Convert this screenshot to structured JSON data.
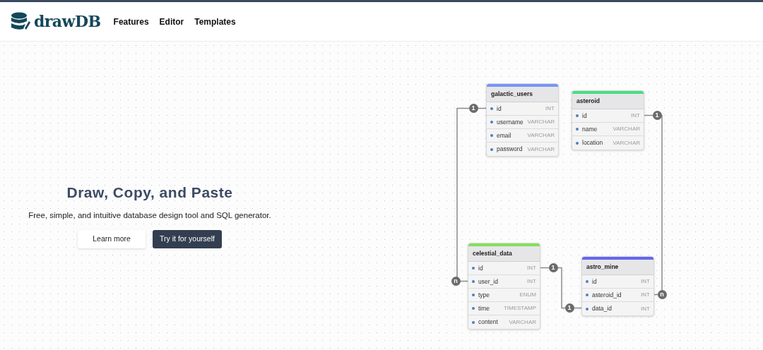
{
  "nav": {
    "logo_text": "drawDB",
    "links": [
      "Features",
      "Editor",
      "Templates"
    ]
  },
  "hero": {
    "title": "Draw, Copy, and Paste",
    "subtitle": "Free, simple, and intuitive database design tool and SQL generator.",
    "buttons": [
      {
        "label": "Learn more",
        "kind": "secondary"
      },
      {
        "label": "Try it for yourself",
        "kind": "primary"
      }
    ]
  },
  "tables": [
    {
      "name": "galactic_users",
      "color": "#7895f5",
      "fields": [
        {
          "name": "id",
          "type": "INT"
        },
        {
          "name": "username",
          "type": "VARCHAR"
        },
        {
          "name": "email",
          "type": "VARCHAR"
        },
        {
          "name": "password",
          "type": "VARCHAR"
        }
      ]
    },
    {
      "name": "asteroid",
      "color": "#4ade80",
      "fields": [
        {
          "name": "id",
          "type": "INT"
        },
        {
          "name": "name",
          "type": "VARCHAR"
        },
        {
          "name": "location",
          "type": "VARCHAR"
        }
      ]
    },
    {
      "name": "celestial_data",
      "color": "#84e05a",
      "fields": [
        {
          "name": "id",
          "type": "INT"
        },
        {
          "name": "user_id",
          "type": "INT"
        },
        {
          "name": "type",
          "type": "ENUM"
        },
        {
          "name": "time",
          "type": "TIMESTAMP"
        },
        {
          "name": "content",
          "type": "VARCHAR"
        }
      ]
    },
    {
      "name": "astro_mine",
      "color": "#6366f1",
      "fields": [
        {
          "name": "id",
          "type": "INT"
        },
        {
          "name": "asteroid_id",
          "type": "INT"
        },
        {
          "name": "data_id",
          "type": "INT"
        }
      ]
    }
  ],
  "relationships": [
    {
      "start_label": "1",
      "end_label": "n"
    },
    {
      "start_label": "1",
      "end_label": "n"
    },
    {
      "start_label": "1",
      "end_label": "1"
    }
  ]
}
